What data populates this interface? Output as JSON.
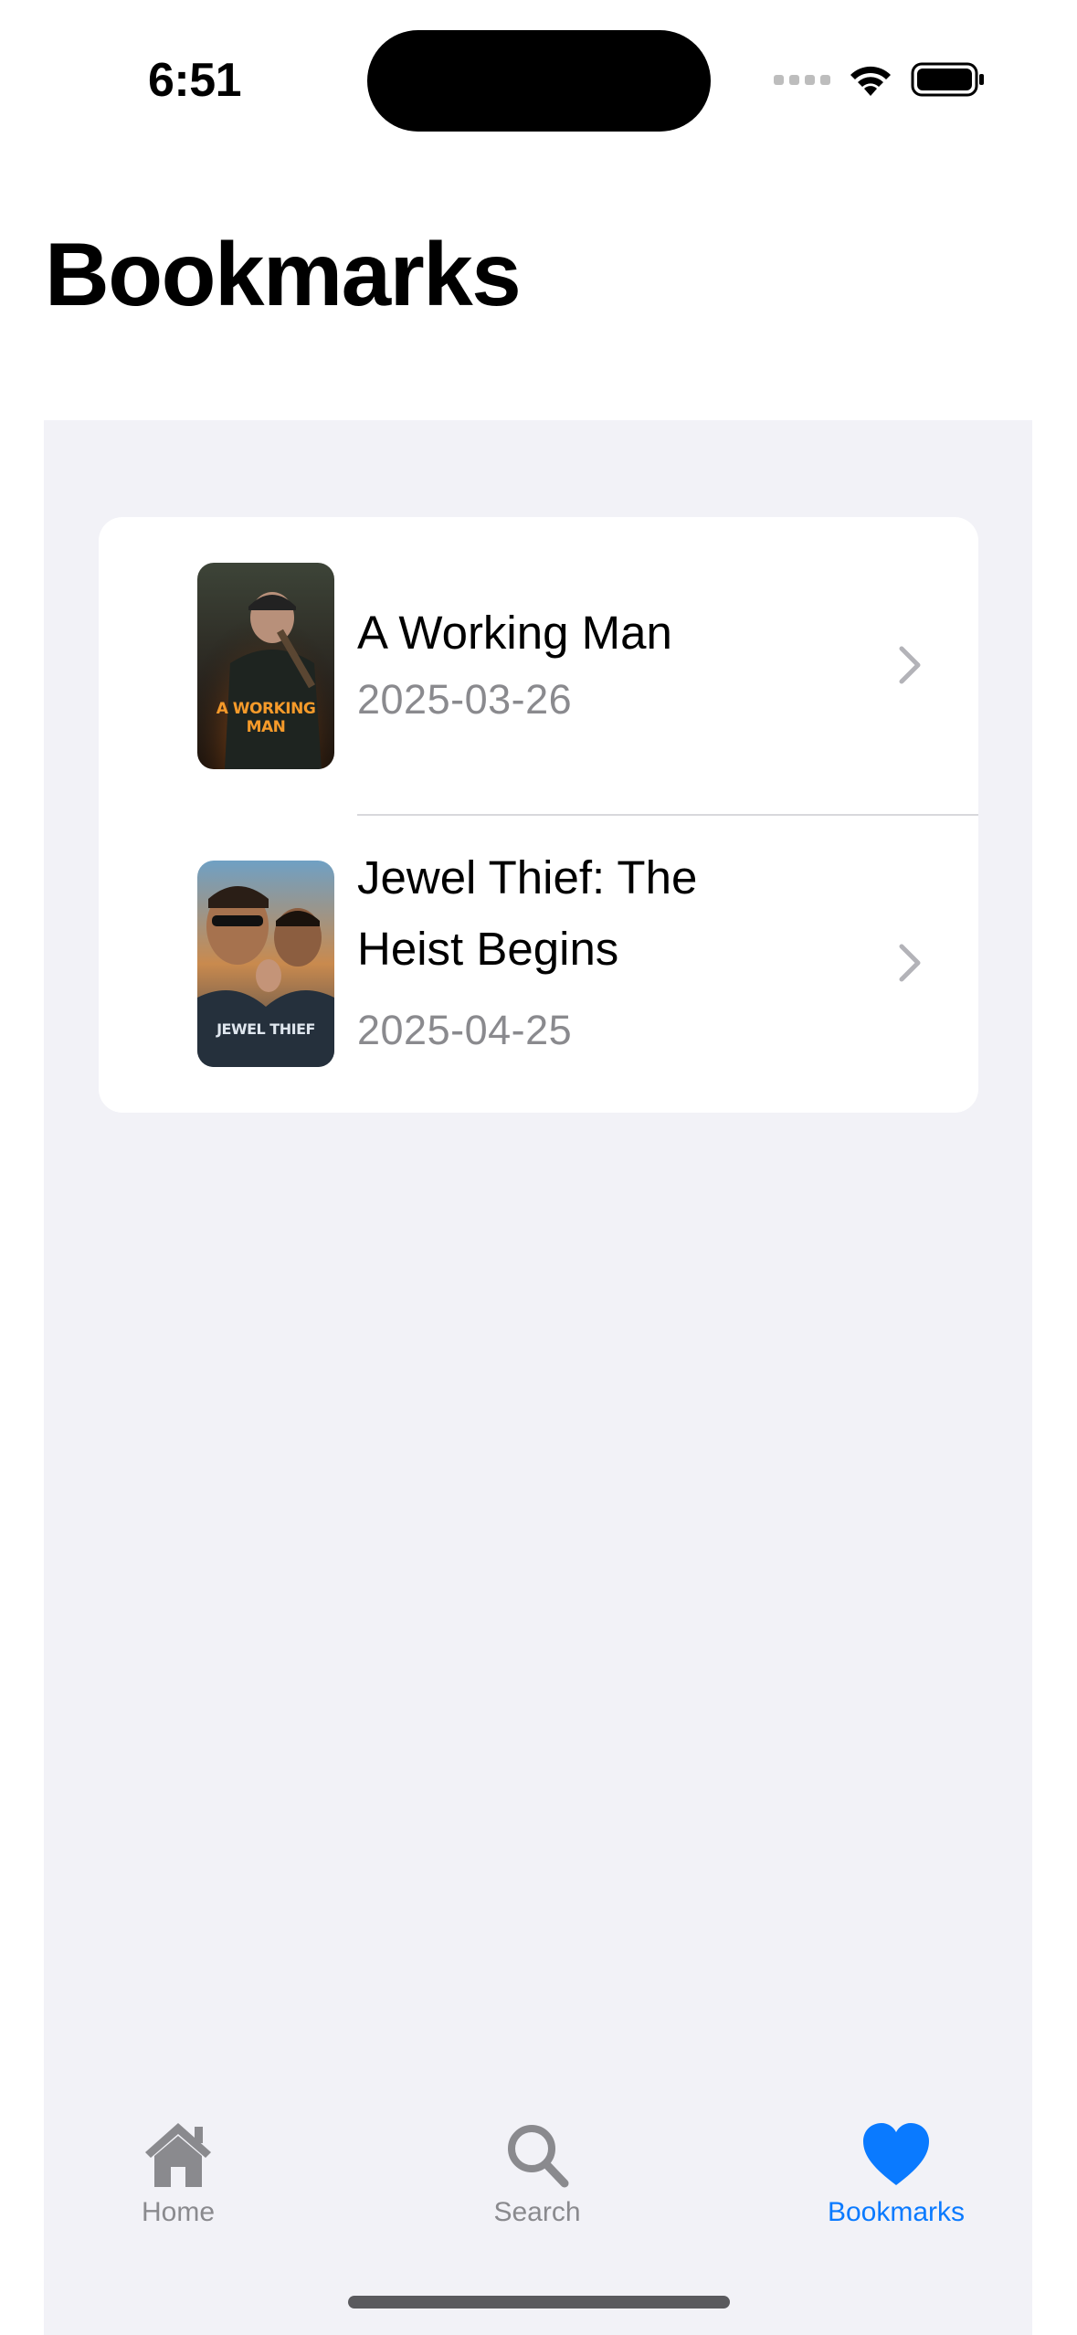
{
  "status_bar": {
    "time": "6:51"
  },
  "page": {
    "title": "Bookmarks"
  },
  "bookmarks": [
    {
      "title": "A Working Man",
      "date": "2025-03-26",
      "poster_text": "A WORKING MAN"
    },
    {
      "title": "Jewel Thief: The Heist Begins",
      "date": "2025-04-25",
      "poster_text": "JEWEL THIEF"
    }
  ],
  "tab_bar": {
    "tabs": [
      {
        "label": "Home",
        "icon": "house-icon",
        "active": false
      },
      {
        "label": "Search",
        "icon": "magnifying-glass-icon",
        "active": false
      },
      {
        "label": "Bookmarks",
        "icon": "heart-icon",
        "active": true
      }
    ]
  },
  "colors": {
    "accent": "#0a7aff",
    "inactive": "#8a8a8e",
    "grouped_background": "#f2f2f7"
  }
}
